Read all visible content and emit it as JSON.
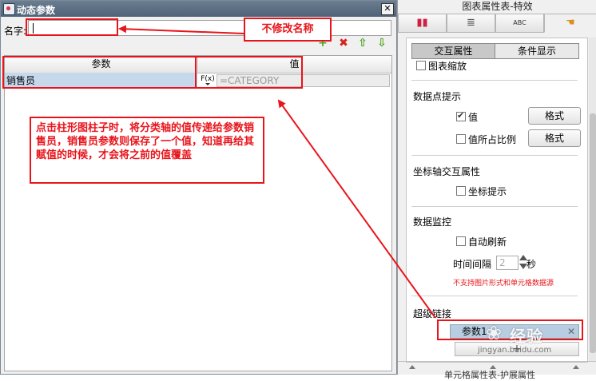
{
  "dialog": {
    "title": "动态参数",
    "close_glyph": "✕",
    "name_label": "名字:",
    "name_value": "",
    "toolbar": {
      "add_glyph": "+",
      "delete_glyph": "✖",
      "up_glyph": "⇧",
      "down_glyph": "⇩"
    },
    "table": {
      "headers": [
        "参数",
        "值"
      ],
      "rows": [
        {
          "name": "销售员",
          "fx_label": "F(x)",
          "value": "=CATEGORY"
        }
      ]
    }
  },
  "annotations": {
    "name_callout": "不修改名称",
    "desc_callout": "点击柱形图柱子时，将分类轴的值传递给参数销售员，销售员参数则保存了一个值，知道再给其赋值的时候，才会将之前的值覆盖",
    "color": "#e8141b"
  },
  "panel": {
    "title": "图表属性表-特效",
    "icon_tabs": [
      {
        "icon": "bar-chart-icon",
        "glyph": "▮▮"
      },
      {
        "icon": "database-icon",
        "glyph": "≣"
      },
      {
        "icon": "text-style-icon",
        "glyph": "ABC"
      },
      {
        "icon": "hand-effect-icon",
        "glyph": "☚"
      }
    ],
    "seg_tabs": {
      "interaction": "交互属性",
      "condition": "条件显示"
    },
    "cut_label": "图表缩放",
    "datapoint": {
      "title": "数据点提示",
      "value_label": "值",
      "value_checked": true,
      "ratio_label": "值所占比例",
      "ratio_checked": false,
      "format_label": "格式"
    },
    "axis": {
      "title": "坐标轴交互属性",
      "tip_label": "坐标提示"
    },
    "monitor": {
      "title": "数据监控",
      "auto_refresh_label": "自动刷新",
      "interval_label": "时间间隔",
      "interval_value": "2",
      "unit": "秒",
      "warning": "不支持图片形式和单元格数据源"
    },
    "hyperlink": {
      "title": "超级链接",
      "item_label": "参数1",
      "close_glyph": "✕",
      "add_glyph": "+"
    },
    "bottom_label": "单元格属性表-护展属性"
  },
  "watermark": {
    "text": "经验",
    "url": "jingyan.baidu.com"
  }
}
